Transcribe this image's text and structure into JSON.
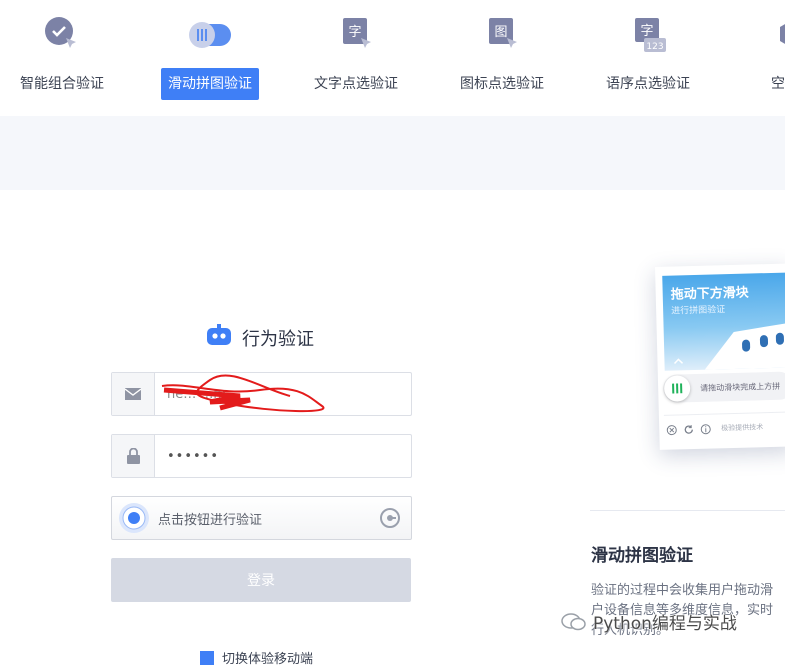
{
  "tabs": [
    {
      "label": "智能组合验证",
      "icon": "check-cursor-icon",
      "active": false
    },
    {
      "label": "滑动拼图验证",
      "icon": "slider-toggle-icon",
      "active": true
    },
    {
      "label": "文字点选验证",
      "icon": "text-char-cursor-icon",
      "active": false
    },
    {
      "label": "图标点选验证",
      "icon": "image-char-cursor-icon",
      "active": false
    },
    {
      "label": "语序点选验证",
      "icon": "word-order-123-icon",
      "active": false
    },
    {
      "label": "空间推",
      "icon": "cube-icon",
      "active": false
    }
  ],
  "login": {
    "title": "行为验证",
    "email_value": "he… …m",
    "password_value": "••••••",
    "captcha_text": "点击按钮进行验证",
    "submit_label": "登录",
    "bottom_link": "切换体验移动端"
  },
  "preview": {
    "header": "拖动下方滑块",
    "subheader": "进行拼图验证",
    "slider_text": "请拖动滑块完成上方拼",
    "footer_text": "极验提供技术"
  },
  "section": {
    "title": "滑动拼图验证",
    "desc_line1": "验证的过程中会收集用户拖动滑",
    "desc_line2": "户设备信息等多维度信息，实时",
    "desc_line3": "行人机识别。"
  },
  "watermark": "Python编程与实战",
  "colors": {
    "accent": "#3f7ff6",
    "icon": "#7c82a6",
    "disabled_button": "#d5d9e3",
    "annotation": "#e31b1b"
  }
}
